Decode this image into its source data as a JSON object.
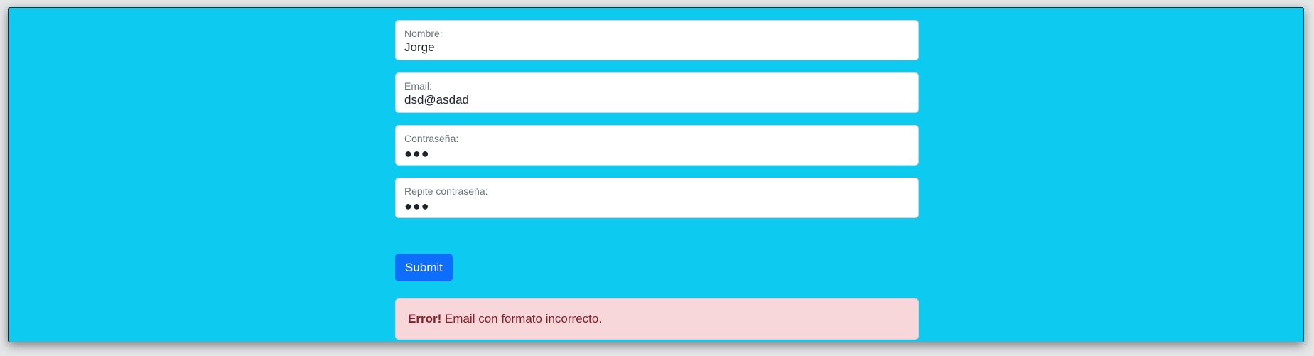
{
  "form": {
    "fields": [
      {
        "label": "Nombre:",
        "value": "Jorge",
        "type": "text"
      },
      {
        "label": "Email:",
        "value": "dsd@asdad",
        "type": "email"
      },
      {
        "label": "Contraseña:",
        "value": "●●●",
        "type": "password"
      },
      {
        "label": "Repite contraseña:",
        "value": "●●●",
        "type": "password"
      }
    ],
    "submit_label": "Submit"
  },
  "alert": {
    "prefix": "Error!",
    "message": "Email con formato incorrecto."
  },
  "colors": {
    "background": "#0dcaf0",
    "button": "#0d6efd",
    "alert_background": "#f8d7da",
    "alert_text": "#842029"
  }
}
